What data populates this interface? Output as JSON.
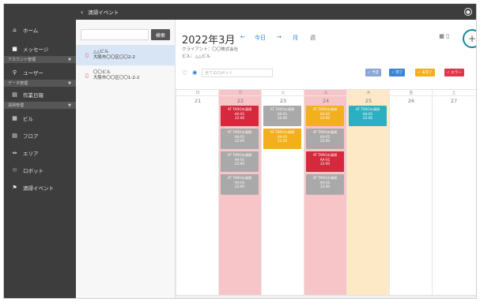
{
  "topbar": {
    "back_icon": "chevron-left-icon",
    "title": "清掃イベント"
  },
  "sidebar": {
    "items_top": [
      {
        "icon": "home-icon",
        "glyph": "⌂",
        "label": "ホーム"
      },
      {
        "icon": "message-icon",
        "glyph": "■",
        "label": "メッセージ"
      }
    ],
    "section_account": "アカウント管理",
    "item_user": {
      "icon": "user-icon",
      "glyph": "⚲",
      "label": "ユーザー"
    },
    "section_data": "データ管理",
    "item_work": {
      "icon": "work-log-icon",
      "glyph": "▤",
      "label": "作業日報"
    },
    "section_clean": "清掃管理",
    "items_clean": [
      {
        "icon": "building-icon",
        "glyph": "▦",
        "label": "ビル"
      },
      {
        "icon": "floor-icon",
        "glyph": "▤",
        "label": "フロア"
      },
      {
        "icon": "area-icon",
        "glyph": "⇔",
        "label": "エリア"
      },
      {
        "icon": "robot-icon",
        "glyph": "☉",
        "label": "ロボット"
      },
      {
        "icon": "cleaning-event-icon",
        "glyph": "⚑",
        "label": "清掃イベント"
      }
    ]
  },
  "buildings": {
    "search_placeholder": "",
    "search_label": "検索",
    "items": [
      {
        "name": "△△ビル",
        "address": "大阪市〇〇区〇〇2-2",
        "selected": true
      },
      {
        "name": "〇〇ビル",
        "address": "大阪市〇〇区〇〇1-2-2",
        "selected": false
      }
    ]
  },
  "calendar": {
    "month": "2022年3月",
    "prev_label": "←",
    "today_label": "今日",
    "next_label": "→",
    "month_view_label": "月",
    "week_view_label": "週",
    "client": "クライアント：〇〇株式会社",
    "building": "ビル：△△ビル",
    "filter_placeholder": "全てのロボット",
    "add_label": "+",
    "view_icons": "▦ ▯",
    "chips": [
      {
        "label": "予定",
        "color": "#8aa6d8"
      },
      {
        "label": "完了",
        "color": "#3a86d6"
      },
      {
        "label": "未完了",
        "color": "#f2b01e"
      },
      {
        "label": "エラー",
        "color": "#e0354a"
      }
    ],
    "days": [
      {
        "dow": "日",
        "num": "21",
        "bg": "#ffffff"
      },
      {
        "dow": "月",
        "num": "22",
        "bg": "#f7c5c8"
      },
      {
        "dow": "火",
        "num": "23",
        "bg": "#ffffff"
      },
      {
        "dow": "水",
        "num": "24",
        "bg": "#f7c5c8"
      },
      {
        "dow": "木",
        "num": "25",
        "bg": "#fde9c6"
      },
      {
        "dow": "金",
        "num": "26",
        "bg": "#ffffff"
      },
      {
        "dow": "土",
        "num": "27",
        "bg": "#ffffff"
      }
    ],
    "event_lines": [
      "AT TAROの清掃",
      "AA-01",
      "22:00"
    ],
    "events": [
      {
        "day": 1,
        "row": 0,
        "color": "#d6293d"
      },
      {
        "day": 1,
        "row": 1,
        "color": "#a9a9a9"
      },
      {
        "day": 1,
        "row": 2,
        "color": "#a9a9a9"
      },
      {
        "day": 1,
        "row": 3,
        "color": "#a9a9a9"
      },
      {
        "day": 2,
        "row": 0,
        "color": "#a9a9a9"
      },
      {
        "day": 2,
        "row": 1,
        "color": "#f2b01e"
      },
      {
        "day": 3,
        "row": 0,
        "color": "#f2b01e"
      },
      {
        "day": 3,
        "row": 1,
        "color": "#a9a9a9"
      },
      {
        "day": 3,
        "row": 2,
        "color": "#d6293d"
      },
      {
        "day": 3,
        "row": 3,
        "color": "#a9a9a9"
      },
      {
        "day": 4,
        "row": 0,
        "color": "#2bb0c2"
      }
    ]
  }
}
